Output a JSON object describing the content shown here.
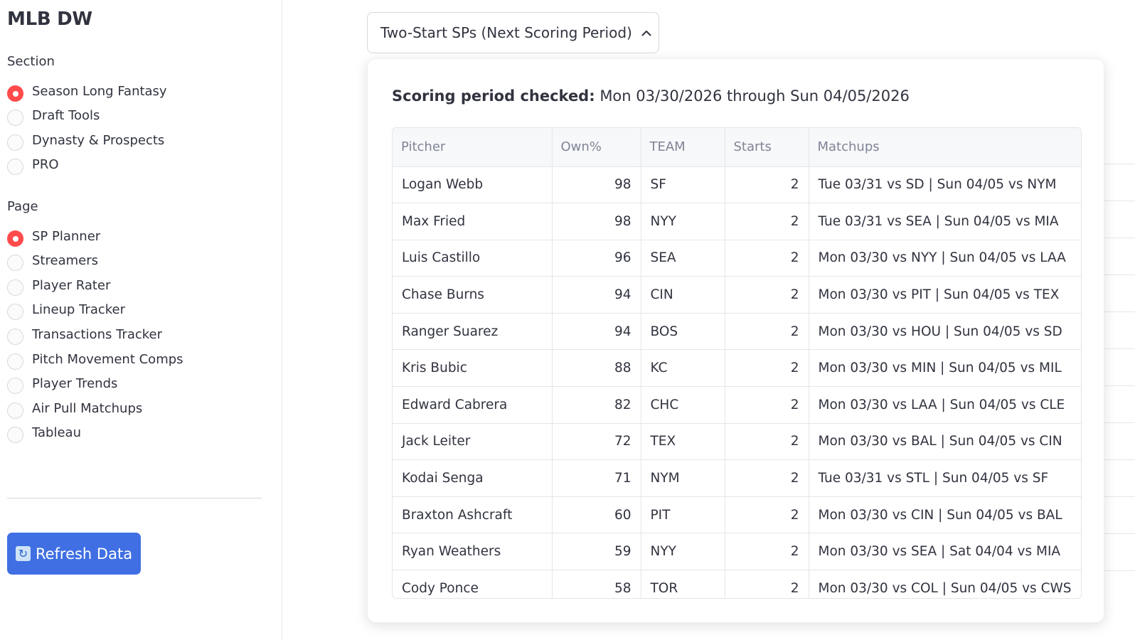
{
  "sidebar": {
    "app_title": "MLB DW",
    "section_label": "Section",
    "section_options": [
      {
        "label": "Season Long Fantasy",
        "checked": true
      },
      {
        "label": "Draft Tools",
        "checked": false
      },
      {
        "label": "Dynasty & Prospects",
        "checked": false
      },
      {
        "label": "PRO",
        "checked": false
      }
    ],
    "page_label": "Page",
    "page_options": [
      {
        "label": "SP Planner",
        "checked": true
      },
      {
        "label": "Streamers",
        "checked": false
      },
      {
        "label": "Player Rater",
        "checked": false
      },
      {
        "label": "Lineup Tracker",
        "checked": false
      },
      {
        "label": "Transactions Tracker",
        "checked": false
      },
      {
        "label": "Pitch Movement Comps",
        "checked": false
      },
      {
        "label": "Player Trends",
        "checked": false
      },
      {
        "label": "Air Pull Matchups",
        "checked": false
      },
      {
        "label": "Tableau",
        "checked": false
      }
    ],
    "refresh_button": {
      "icon": "refresh-icon",
      "label": "Refresh Data"
    }
  },
  "main": {
    "popover_trigger": {
      "label": "Two-Start SPs (Next Scoring Period)",
      "icon": "chevron-up-icon"
    },
    "popover": {
      "period_bold": "Scoring period checked:",
      "period_text": "Mon 03/30/2026 through Sun 04/05/2026",
      "table": {
        "columns": [
          "Pitcher",
          "Own%",
          "TEAM",
          "Starts",
          "Matchups"
        ],
        "rows": [
          [
            "Logan Webb",
            "98",
            "SF",
            "2",
            "Tue 03/31 vs SD | Sun 04/05 vs NYM"
          ],
          [
            "Max Fried",
            "98",
            "NYY",
            "2",
            "Tue 03/31 vs SEA | Sun 04/05 vs MIA"
          ],
          [
            "Luis Castillo",
            "96",
            "SEA",
            "2",
            "Mon 03/30 vs NYY | Sun 04/05 vs LAA"
          ],
          [
            "Chase Burns",
            "94",
            "CIN",
            "2",
            "Mon 03/30 vs PIT | Sun 04/05 vs TEX"
          ],
          [
            "Ranger Suarez",
            "94",
            "BOS",
            "2",
            "Mon 03/30 vs HOU | Sun 04/05 vs SD"
          ],
          [
            "Kris Bubic",
            "88",
            "KC",
            "2",
            "Mon 03/30 vs MIN | Sun 04/05 vs MIL"
          ],
          [
            "Edward Cabrera",
            "82",
            "CHC",
            "2",
            "Mon 03/30 vs LAA | Sun 04/05 vs CLE"
          ],
          [
            "Jack Leiter",
            "72",
            "TEX",
            "2",
            "Mon 03/30 vs BAL | Sun 04/05 vs CIN"
          ],
          [
            "Kodai Senga",
            "71",
            "NYM",
            "2",
            "Tue 03/31 vs STL | Sun 04/05 vs SF"
          ],
          [
            "Braxton Ashcraft",
            "60",
            "PIT",
            "2",
            "Mon 03/30 vs CIN | Sun 04/05 vs BAL"
          ],
          [
            "Ryan Weathers",
            "59",
            "NYY",
            "2",
            "Mon 03/30 vs SEA | Sat 04/04 vs MIA"
          ],
          [
            "Cody Ponce",
            "58",
            "TOR",
            "2",
            "Mon 03/30 vs COL | Sun 04/05 vs CWS"
          ]
        ]
      }
    }
  },
  "colors": {
    "accent": "#ff4b4b",
    "button": "#3f6fe2",
    "text": "#31333f",
    "header_text": "#808495"
  }
}
